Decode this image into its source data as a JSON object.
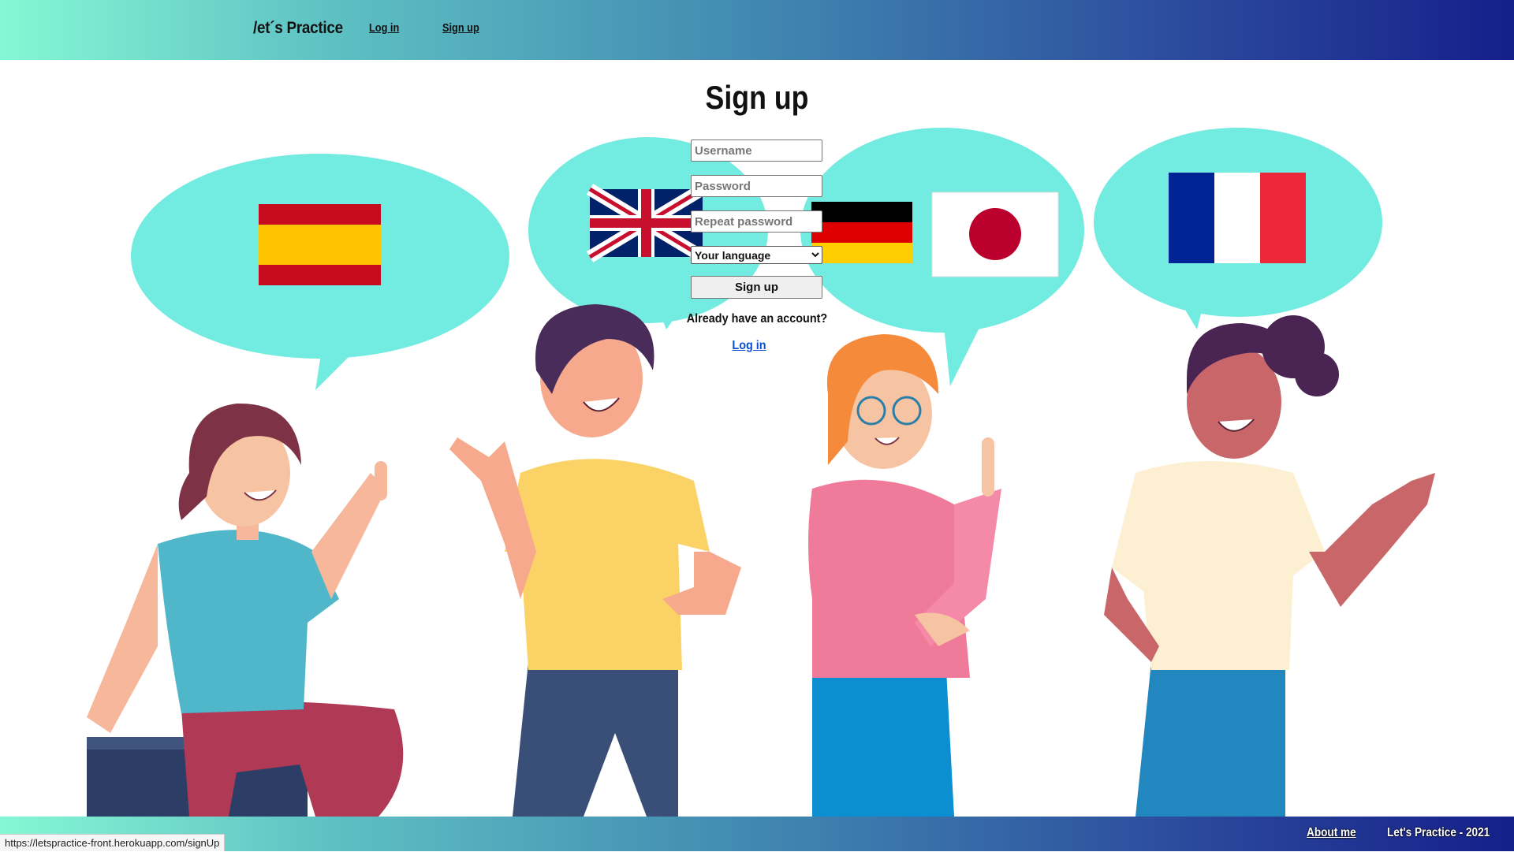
{
  "nav": {
    "brand": "/et´s Practice",
    "login_label": "Log in",
    "signup_label": "Sign up"
  },
  "form": {
    "title": "Sign up",
    "username_placeholder": "Username",
    "password_placeholder": "Password",
    "repeat_placeholder": "Repeat password",
    "language_selected": "Your language",
    "submit_label": "Sign up",
    "already_text": "Already have an account?",
    "login_link": "Log in"
  },
  "flags": [
    "spain-flag-icon",
    "uk-flag-icon",
    "germany-flag-icon",
    "japan-flag-icon",
    "france-flag-icon"
  ],
  "footer": {
    "about_label": "About me",
    "copyright": "Let's Practice - 2021"
  },
  "status_url": "https://letspractice-front.herokuapp.com/signUp",
  "colors": {
    "bubble": "#72ebe0",
    "gradient_start": "#86f7d4",
    "gradient_end": "#151f8a",
    "link": "#0a4fd6"
  }
}
